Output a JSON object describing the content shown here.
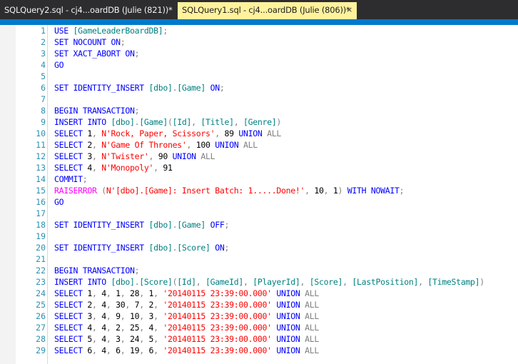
{
  "tabs": [
    {
      "title": "SQLQuery2.sql - cj4...oardDB (Julie (821))*",
      "active": false
    },
    {
      "title": "SQLQuery1.sql - cj4...oardDB (Julie (806))*",
      "active": true
    }
  ],
  "close_glyph": "×",
  "editor": {
    "line_numbers": [
      "1",
      "2",
      "3",
      "4",
      "5",
      "6",
      "7",
      "8",
      "9",
      "10",
      "11",
      "12",
      "13",
      "14",
      "15",
      "16",
      "17",
      "18",
      "19",
      "20",
      "21",
      "22",
      "23",
      "24",
      "25",
      "26",
      "27",
      "28",
      "29"
    ],
    "lines": [
      [
        {
          "t": "USE ",
          "c": "k"
        },
        {
          "t": "[GameLeaderBoardDB]",
          "c": "t"
        },
        {
          "t": ";",
          "c": "g"
        }
      ],
      [
        {
          "t": "SET NOCOUNT ON",
          "c": "k"
        },
        {
          "t": ";",
          "c": "g"
        }
      ],
      [
        {
          "t": "SET XACT_ABORT ON",
          "c": "k"
        },
        {
          "t": ";",
          "c": "g"
        }
      ],
      [
        {
          "t": "GO",
          "c": "k"
        }
      ],
      [],
      [
        {
          "t": "SET IDENTITY_INSERT ",
          "c": "k"
        },
        {
          "t": "[dbo]",
          "c": "t"
        },
        {
          "t": ".",
          "c": "g"
        },
        {
          "t": "[Game]",
          "c": "t"
        },
        {
          "t": " ON",
          "c": "k"
        },
        {
          "t": ";",
          "c": "g"
        }
      ],
      [],
      [
        {
          "t": "BEGIN TRANSACTION",
          "c": "k"
        },
        {
          "t": ";",
          "c": "g"
        }
      ],
      [
        {
          "t": "INSERT INTO ",
          "c": "k"
        },
        {
          "t": "[dbo]",
          "c": "t"
        },
        {
          "t": ".",
          "c": "g"
        },
        {
          "t": "[Game]",
          "c": "t"
        },
        {
          "t": "(",
          "c": "g"
        },
        {
          "t": "[Id]",
          "c": "t"
        },
        {
          "t": ", ",
          "c": "g"
        },
        {
          "t": "[Title]",
          "c": "t"
        },
        {
          "t": ", ",
          "c": "g"
        },
        {
          "t": "[Genre]",
          "c": "t"
        },
        {
          "t": ")",
          "c": "g"
        }
      ],
      [
        {
          "t": "SELECT ",
          "c": "k"
        },
        {
          "t": "1",
          "c": ""
        },
        {
          "t": ", ",
          "c": "g"
        },
        {
          "t": "N'Rock, Paper, Scissors'",
          "c": "s"
        },
        {
          "t": ", ",
          "c": "g"
        },
        {
          "t": "89 ",
          "c": ""
        },
        {
          "t": "UNION ",
          "c": "k"
        },
        {
          "t": "ALL",
          "c": "g"
        }
      ],
      [
        {
          "t": "SELECT ",
          "c": "k"
        },
        {
          "t": "2",
          "c": ""
        },
        {
          "t": ", ",
          "c": "g"
        },
        {
          "t": "N'Game Of Thrones'",
          "c": "s"
        },
        {
          "t": ", ",
          "c": "g"
        },
        {
          "t": "100 ",
          "c": ""
        },
        {
          "t": "UNION ",
          "c": "k"
        },
        {
          "t": "ALL",
          "c": "g"
        }
      ],
      [
        {
          "t": "SELECT ",
          "c": "k"
        },
        {
          "t": "3",
          "c": ""
        },
        {
          "t": ", ",
          "c": "g"
        },
        {
          "t": "N'Twister'",
          "c": "s"
        },
        {
          "t": ", ",
          "c": "g"
        },
        {
          "t": "90 ",
          "c": ""
        },
        {
          "t": "UNION ",
          "c": "k"
        },
        {
          "t": "ALL",
          "c": "g"
        }
      ],
      [
        {
          "t": "SELECT ",
          "c": "k"
        },
        {
          "t": "4",
          "c": ""
        },
        {
          "t": ", ",
          "c": "g"
        },
        {
          "t": "N'Monopoly'",
          "c": "s"
        },
        {
          "t": ", ",
          "c": "g"
        },
        {
          "t": "91",
          "c": ""
        }
      ],
      [
        {
          "t": "COMMIT",
          "c": "k"
        },
        {
          "t": ";",
          "c": "g"
        }
      ],
      [
        {
          "t": "RAISERROR ",
          "c": "f"
        },
        {
          "t": "(",
          "c": "g"
        },
        {
          "t": "N'[dbo].[Game]: Insert Batch: 1.....Done!'",
          "c": "s"
        },
        {
          "t": ", ",
          "c": "g"
        },
        {
          "t": "10",
          "c": ""
        },
        {
          "t": ", ",
          "c": "g"
        },
        {
          "t": "1",
          "c": ""
        },
        {
          "t": ") ",
          "c": "g"
        },
        {
          "t": "WITH NOWAIT",
          "c": "k"
        },
        {
          "t": ";",
          "c": "g"
        }
      ],
      [
        {
          "t": "GO",
          "c": "k"
        }
      ],
      [],
      [
        {
          "t": "SET IDENTITY_INSERT ",
          "c": "k"
        },
        {
          "t": "[dbo]",
          "c": "t"
        },
        {
          "t": ".",
          "c": "g"
        },
        {
          "t": "[Game]",
          "c": "t"
        },
        {
          "t": " OFF",
          "c": "k"
        },
        {
          "t": ";",
          "c": "g"
        }
      ],
      [],
      [
        {
          "t": "SET IDENTITY_INSERT ",
          "c": "k"
        },
        {
          "t": "[dbo]",
          "c": "t"
        },
        {
          "t": ".",
          "c": "g"
        },
        {
          "t": "[Score]",
          "c": "t"
        },
        {
          "t": " ON",
          "c": "k"
        },
        {
          "t": ";",
          "c": "g"
        }
      ],
      [],
      [
        {
          "t": "BEGIN TRANSACTION",
          "c": "k"
        },
        {
          "t": ";",
          "c": "g"
        }
      ],
      [
        {
          "t": "INSERT INTO ",
          "c": "k"
        },
        {
          "t": "[dbo]",
          "c": "t"
        },
        {
          "t": ".",
          "c": "g"
        },
        {
          "t": "[Score]",
          "c": "t"
        },
        {
          "t": "(",
          "c": "g"
        },
        {
          "t": "[Id]",
          "c": "t"
        },
        {
          "t": ", ",
          "c": "g"
        },
        {
          "t": "[GameId]",
          "c": "t"
        },
        {
          "t": ", ",
          "c": "g"
        },
        {
          "t": "[PlayerId]",
          "c": "t"
        },
        {
          "t": ", ",
          "c": "g"
        },
        {
          "t": "[Score]",
          "c": "t"
        },
        {
          "t": ", ",
          "c": "g"
        },
        {
          "t": "[LastPosition]",
          "c": "t"
        },
        {
          "t": ", ",
          "c": "g"
        },
        {
          "t": "[TimeStamp]",
          "c": "t"
        },
        {
          "t": ")",
          "c": "g"
        }
      ],
      [
        {
          "t": "SELECT ",
          "c": "k"
        },
        {
          "t": "1",
          "c": ""
        },
        {
          "t": ", ",
          "c": "g"
        },
        {
          "t": "4",
          "c": ""
        },
        {
          "t": ", ",
          "c": "g"
        },
        {
          "t": "1",
          "c": ""
        },
        {
          "t": ", ",
          "c": "g"
        },
        {
          "t": "28",
          "c": ""
        },
        {
          "t": ", ",
          "c": "g"
        },
        {
          "t": "1",
          "c": ""
        },
        {
          "t": ", ",
          "c": "g"
        },
        {
          "t": "'20140115 23:39:00.000'",
          "c": "s"
        },
        {
          "t": " UNION ",
          "c": "k"
        },
        {
          "t": "ALL",
          "c": "g"
        }
      ],
      [
        {
          "t": "SELECT ",
          "c": "k"
        },
        {
          "t": "2",
          "c": ""
        },
        {
          "t": ", ",
          "c": "g"
        },
        {
          "t": "4",
          "c": ""
        },
        {
          "t": ", ",
          "c": "g"
        },
        {
          "t": "30",
          "c": ""
        },
        {
          "t": ", ",
          "c": "g"
        },
        {
          "t": "7",
          "c": ""
        },
        {
          "t": ", ",
          "c": "g"
        },
        {
          "t": "2",
          "c": ""
        },
        {
          "t": ", ",
          "c": "g"
        },
        {
          "t": "'20140115 23:39:00.000'",
          "c": "s"
        },
        {
          "t": " UNION ",
          "c": "k"
        },
        {
          "t": "ALL",
          "c": "g"
        }
      ],
      [
        {
          "t": "SELECT ",
          "c": "k"
        },
        {
          "t": "3",
          "c": ""
        },
        {
          "t": ", ",
          "c": "g"
        },
        {
          "t": "4",
          "c": ""
        },
        {
          "t": ", ",
          "c": "g"
        },
        {
          "t": "9",
          "c": ""
        },
        {
          "t": ", ",
          "c": "g"
        },
        {
          "t": "10",
          "c": ""
        },
        {
          "t": ", ",
          "c": "g"
        },
        {
          "t": "3",
          "c": ""
        },
        {
          "t": ", ",
          "c": "g"
        },
        {
          "t": "'20140115 23:39:00.000'",
          "c": "s"
        },
        {
          "t": " UNION ",
          "c": "k"
        },
        {
          "t": "ALL",
          "c": "g"
        }
      ],
      [
        {
          "t": "SELECT ",
          "c": "k"
        },
        {
          "t": "4",
          "c": ""
        },
        {
          "t": ", ",
          "c": "g"
        },
        {
          "t": "4",
          "c": ""
        },
        {
          "t": ", ",
          "c": "g"
        },
        {
          "t": "2",
          "c": ""
        },
        {
          "t": ", ",
          "c": "g"
        },
        {
          "t": "25",
          "c": ""
        },
        {
          "t": ", ",
          "c": "g"
        },
        {
          "t": "4",
          "c": ""
        },
        {
          "t": ", ",
          "c": "g"
        },
        {
          "t": "'20140115 23:39:00.000'",
          "c": "s"
        },
        {
          "t": " UNION ",
          "c": "k"
        },
        {
          "t": "ALL",
          "c": "g"
        }
      ],
      [
        {
          "t": "SELECT ",
          "c": "k"
        },
        {
          "t": "5",
          "c": ""
        },
        {
          "t": ", ",
          "c": "g"
        },
        {
          "t": "4",
          "c": ""
        },
        {
          "t": ", ",
          "c": "g"
        },
        {
          "t": "3",
          "c": ""
        },
        {
          "t": ", ",
          "c": "g"
        },
        {
          "t": "24",
          "c": ""
        },
        {
          "t": ", ",
          "c": "g"
        },
        {
          "t": "5",
          "c": ""
        },
        {
          "t": ", ",
          "c": "g"
        },
        {
          "t": "'20140115 23:39:00.000'",
          "c": "s"
        },
        {
          "t": " UNION ",
          "c": "k"
        },
        {
          "t": "ALL",
          "c": "g"
        }
      ],
      [
        {
          "t": "SELECT ",
          "c": "k"
        },
        {
          "t": "6",
          "c": ""
        },
        {
          "t": ", ",
          "c": "g"
        },
        {
          "t": "4",
          "c": ""
        },
        {
          "t": ", ",
          "c": "g"
        },
        {
          "t": "6",
          "c": ""
        },
        {
          "t": ", ",
          "c": "g"
        },
        {
          "t": "19",
          "c": ""
        },
        {
          "t": ", ",
          "c": "g"
        },
        {
          "t": "6",
          "c": ""
        },
        {
          "t": ", ",
          "c": "g"
        },
        {
          "t": "'20140115 23:39:00.000'",
          "c": "s"
        },
        {
          "t": " UNION ",
          "c": "k"
        },
        {
          "t": "ALL",
          "c": "g"
        }
      ]
    ]
  },
  "colors": {
    "keyword": "#0000ff",
    "string": "#ff0000",
    "operator": "#808080",
    "identifier": "#008080",
    "function": "#ff00ff",
    "line_number": "#2b91af",
    "accent": "#007acc",
    "active_tab": "#fff29d"
  }
}
